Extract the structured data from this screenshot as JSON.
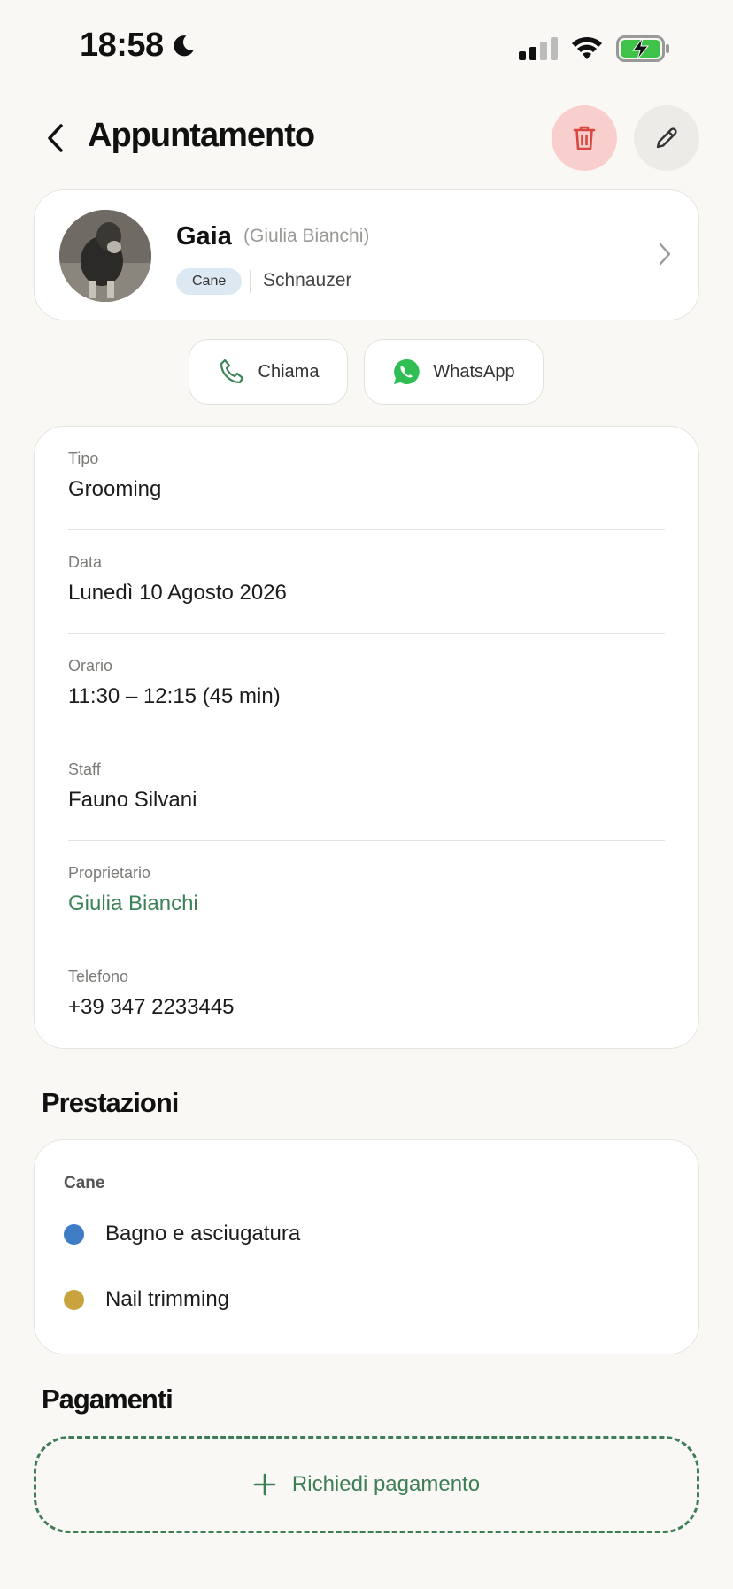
{
  "status_bar": {
    "time": "18:58"
  },
  "header": {
    "title": "Appuntamento"
  },
  "pet": {
    "name": "Gaia",
    "owner_paren": "(Giulia Bianchi)",
    "species": "Cane",
    "breed": "Schnauzer"
  },
  "actions": {
    "call_label": "Chiama",
    "whatsapp_label": "WhatsApp"
  },
  "details": [
    {
      "label": "Tipo",
      "value": "Grooming"
    },
    {
      "label": "Data",
      "value": "Lunedì 10 Agosto 2026"
    },
    {
      "label": "Orario",
      "value": "11:30 – 12:15 (45 min)"
    },
    {
      "label": "Staff",
      "value": "Fauno Silvani"
    },
    {
      "label": "Proprietario",
      "value": "Giulia Bianchi"
    },
    {
      "label": "Telefono",
      "value": "+39 347 2233445"
    }
  ],
  "services": {
    "title": "Prestazioni",
    "group": "Cane",
    "items": [
      {
        "name": "Bagno e asciugatura",
        "color": "#3e7cc6"
      },
      {
        "name": "Nail trimming",
        "color": "#c9a43e"
      }
    ]
  },
  "payments": {
    "title": "Pagamenti",
    "request_label": "Richiedi pagamento"
  },
  "colors": {
    "accent_green": "#3b8257",
    "delete_bg": "#f8cfcd",
    "delete_icon": "#d9473f"
  }
}
